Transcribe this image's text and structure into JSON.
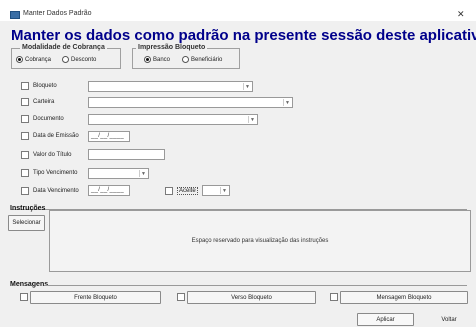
{
  "window": {
    "title": "Manter Dados Padrão",
    "close_glyph": "✕"
  },
  "banner": "Manter os dados como padrão na presente sessão deste aplicativo",
  "modalidade": {
    "label": "Modalidade de Cobrança",
    "options": [
      {
        "label": "Cobrança",
        "selected": true
      },
      {
        "label": "Desconto",
        "selected": false
      }
    ]
  },
  "impressao": {
    "label": "Impressão Bloqueto",
    "options": [
      {
        "label": "Banco",
        "selected": true
      },
      {
        "label": "Beneficiário",
        "selected": false
      }
    ]
  },
  "fields": {
    "bloqueto": {
      "label": "Bloqueto",
      "value": ""
    },
    "carteira": {
      "label": "Carteira",
      "value": ""
    },
    "documento": {
      "label": "Documento",
      "value": ""
    },
    "data_emissao": {
      "label": "Data de Emissão",
      "mask": "__/__/____"
    },
    "valor_titulo": {
      "label": "Valor do Título",
      "value": ""
    },
    "tipo_vencimento": {
      "label": "Tipo Vencimento",
      "value": ""
    },
    "data_vencimento": {
      "label": "Data Vencimento",
      "mask": "__/__/____"
    },
    "aceite": {
      "label": "Aceite",
      "value": ""
    }
  },
  "instrucoes": {
    "label": "Instruções",
    "select_button": "Selecionar",
    "placeholder": "Espaço reservado para visualização das instruções"
  },
  "mensagens": {
    "label": "Mensagens",
    "buttons": [
      "Frente Bloqueto",
      "Verso Bloqueto",
      "Mensagem Bloqueto"
    ]
  },
  "footer": {
    "apply": "Aplicar",
    "back": "Voltar"
  }
}
